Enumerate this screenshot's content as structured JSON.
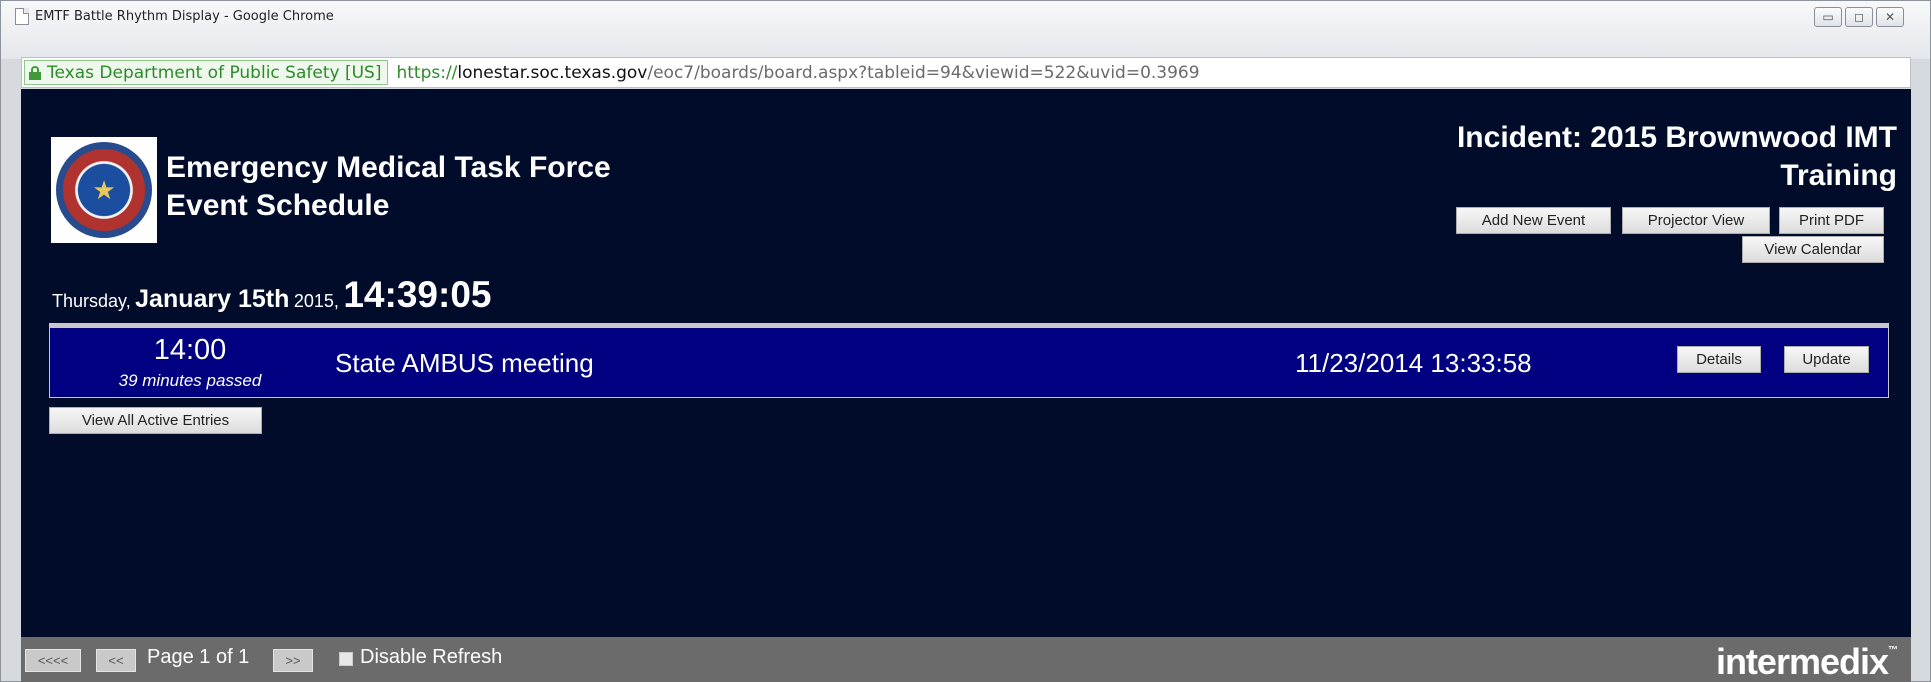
{
  "window": {
    "title": "EMTF Battle Rhythm Display - Google Chrome",
    "controls": {
      "minimize": "▭",
      "maximize": "◻",
      "close": "✕"
    }
  },
  "address_bar": {
    "security_label": "Texas Department of Public Safety [US]",
    "url_scheme": "https://",
    "url_host": "lonestar.soc.texas.gov",
    "url_path": "/eoc7/boards/board.aspx?tableid=94&viewid=522&uvid=0.3969"
  },
  "header": {
    "title_line1": "Emergency Medical Task Force",
    "title_line2": "Event Schedule",
    "incident_line1": "Incident: 2015 Brownwood IMT",
    "incident_line2": "Training"
  },
  "buttons": {
    "add_new_event": "Add New Event",
    "projector_view": "Projector View",
    "print_pdf": "Print PDF",
    "view_calendar": "View Calendar",
    "view_all_active": "View All Active Entries"
  },
  "datetime": {
    "weekday": "Thursday,",
    "date": "January 15th",
    "year": "2015,",
    "time": "14:39:05"
  },
  "events": [
    {
      "time": "14:00",
      "status": "39 minutes passed",
      "name": "State AMBUS meeting",
      "updated": "11/23/2014 13:33:58",
      "details_label": "Details",
      "update_label": "Update"
    }
  ],
  "footer": {
    "first": "<<<<",
    "prev": "<<",
    "page_text": "Page 1 of 1",
    "next": ">>",
    "disable_refresh": "Disable Refresh",
    "brand": "intermedix",
    "brand_mark": "™"
  },
  "colors": {
    "board_bg": "#000c2a",
    "event_row_bg": "#000080",
    "footer_bg": "#6b6b6b",
    "secure_green": "#2e8b2a"
  },
  "icons": [
    "page-icon",
    "lock-icon",
    "seal-logo"
  ]
}
